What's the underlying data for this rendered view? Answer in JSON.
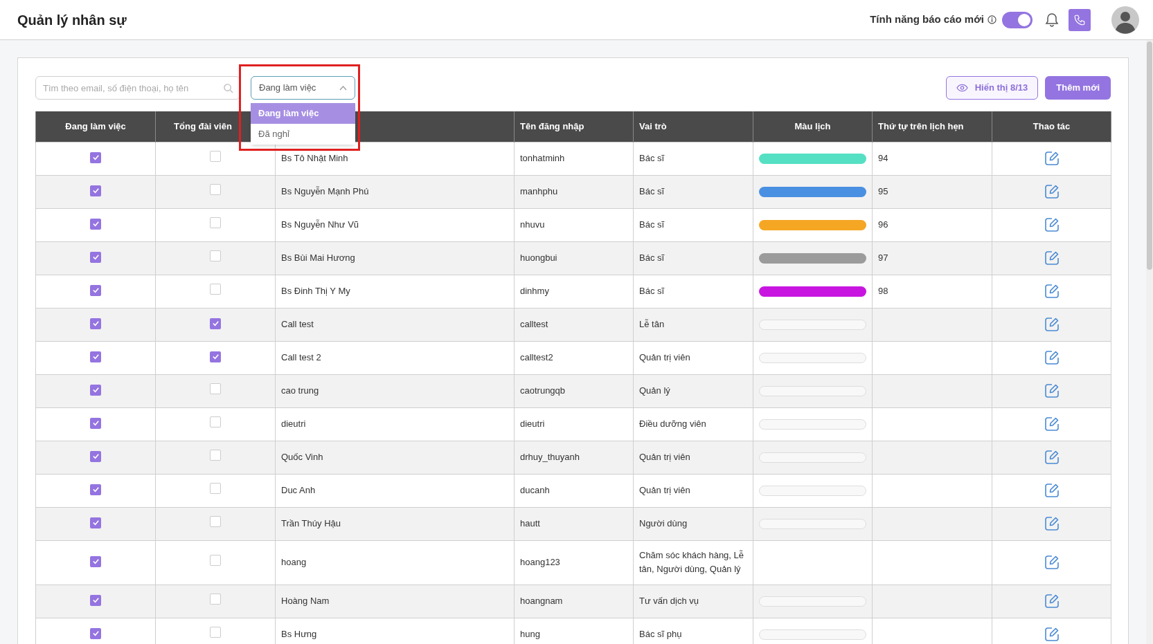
{
  "header": {
    "title": "Quản lý nhân sự",
    "report_toggle": {
      "label": "Tính năng báo cáo mới",
      "on": true
    }
  },
  "toolbar": {
    "search": {
      "placeholder": "Tìm theo email, số điện thoại, họ tên"
    },
    "status_select": {
      "value": "Đang làm việc",
      "expanded": true,
      "options": [
        {
          "label": "Đang làm việc",
          "selected": true
        },
        {
          "label": "Đã nghỉ",
          "selected": false
        }
      ]
    },
    "view_button": "Hiển thị 8/13",
    "add_button": "Thêm mới"
  },
  "table": {
    "columns": [
      {
        "label": "Đang làm việc"
      },
      {
        "label": "Tổng đài viên"
      },
      {},
      {
        "label": "Tên đăng nhập"
      },
      {
        "label": "Vai trò"
      },
      {
        "label": "Màu lịch"
      },
      {
        "label": "Thứ tự trên lịch hẹn"
      },
      {
        "label": "Thao tác"
      }
    ],
    "rows": [
      {
        "working": true,
        "operator": false,
        "name": "Bs Tô Nhật Minh",
        "username": "tonhatminh",
        "role": "Bác sĩ",
        "color_bar": true,
        "color": "#55e0c3",
        "order": "94"
      },
      {
        "working": true,
        "operator": false,
        "name": "Bs Nguyễn Mạnh Phú",
        "username": "manhphu",
        "role": "Bác sĩ",
        "color_bar": true,
        "color": "#4a90e2",
        "order": "95"
      },
      {
        "working": true,
        "operator": false,
        "name": "Bs Nguyễn Như Vũ",
        "username": "nhuvu",
        "role": "Bác sĩ",
        "color_bar": true,
        "color": "#f5a623",
        "order": "96"
      },
      {
        "working": true,
        "operator": false,
        "name": "Bs Bùi Mai Hương",
        "username": "huongbui",
        "role": "Bác sĩ",
        "color_bar": true,
        "color": "#9b9b9b",
        "order": "97"
      },
      {
        "working": true,
        "operator": false,
        "name": "Bs Đinh Thị Y My",
        "username": "dinhmy",
        "role": "Bác sĩ",
        "color_bar": true,
        "color": "#c816e0",
        "order": "98"
      },
      {
        "working": true,
        "operator": true,
        "name": "Call test",
        "username": "calltest",
        "role": "Lễ tân",
        "color_bar": true
      },
      {
        "working": true,
        "operator": true,
        "name": "Call test 2",
        "username": "calltest2",
        "role": "Quản trị viên",
        "color_bar": true
      },
      {
        "working": true,
        "operator": false,
        "name": "cao trung",
        "username": "caotrungqb",
        "role": "Quản lý",
        "color_bar": true
      },
      {
        "working": true,
        "operator": false,
        "name": "dieutri",
        "username": "dieutri",
        "role": "Điều dưỡng viên",
        "color_bar": true
      },
      {
        "working": true,
        "operator": false,
        "name": "Quốc Vinh",
        "username": "drhuy_thuyanh",
        "role": "Quản trị viên",
        "color_bar": true
      },
      {
        "working": true,
        "operator": false,
        "name": "Duc Anh",
        "username": "ducanh",
        "role": "Quản trị viên",
        "color_bar": true
      },
      {
        "working": true,
        "operator": false,
        "name": "Trần Thúy Hậu",
        "username": "hautt",
        "role": "Người dùng",
        "color_bar": true
      },
      {
        "working": true,
        "operator": false,
        "name": "hoang",
        "username": "hoang123",
        "role": "Chăm sóc khách hàng, Lễ tân, Người dùng, Quản lý",
        "color_bar": false
      },
      {
        "working": true,
        "operator": false,
        "name": "Hoàng Nam",
        "username": "hoangnam",
        "role": "Tư vấn dịch vụ",
        "color_bar": true
      },
      {
        "working": true,
        "operator": false,
        "name": "Bs Hưng",
        "username": "hung",
        "role": "Bác sĩ phụ",
        "color_bar": true
      }
    ]
  }
}
